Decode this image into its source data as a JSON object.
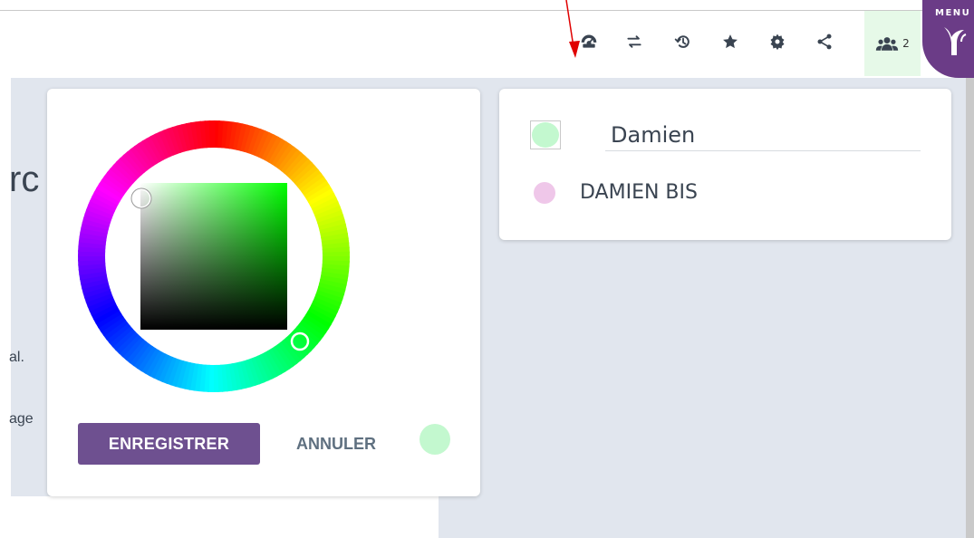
{
  "toolbar": {
    "icons": [
      "dashboard-icon",
      "swap-icon",
      "history-icon",
      "star-icon",
      "gear-icon",
      "share-icon"
    ],
    "users": {
      "icon": "users-icon",
      "count": "2",
      "bg_color": "#e6f9e8"
    },
    "menu": {
      "label": "MENU",
      "brand_color": "#6b3c87"
    }
  },
  "background": {
    "title_fragment": "rc",
    "text_fragment_1": "al.",
    "text_fragment_2": "age"
  },
  "color_picker": {
    "selected_color": "#c3f8cf",
    "hue_color": "#00ff00",
    "save_label": "ENREGISTRER",
    "cancel_label": "ANNULER",
    "save_color": "#6e5090"
  },
  "users_panel": {
    "user1": {
      "name": "Damien",
      "color": "#c3f8cf"
    },
    "user2": {
      "name": "DAMIEN BIS",
      "color": "#efc7e9"
    }
  },
  "annotation": {
    "arrow_color": "#e00000"
  }
}
